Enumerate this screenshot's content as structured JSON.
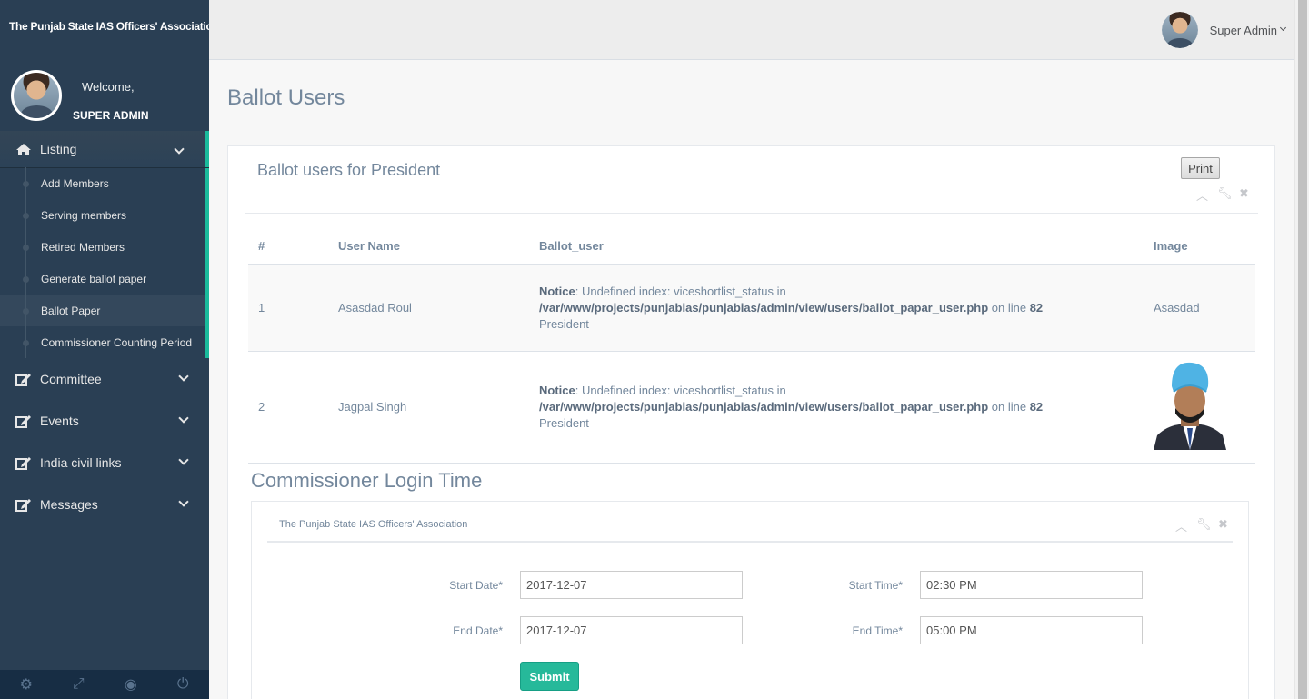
{
  "sidebar": {
    "site_title": "The Punjab State IAS Officers' Association",
    "welcome": "Welcome,",
    "admin_name": "SUPER ADMIN",
    "menu": [
      {
        "label": "Listing",
        "icon": "home-icon",
        "expanded": true,
        "items": [
          "Add Members",
          "Serving members",
          "Retired Members",
          "Generate ballot paper",
          "Ballot Paper",
          "Commissioner Counting Period"
        ]
      },
      {
        "label": "Committee",
        "icon": "edit-icon"
      },
      {
        "label": "Events",
        "icon": "edit-icon"
      },
      {
        "label": "India civil links",
        "icon": "edit-icon"
      },
      {
        "label": "Messages",
        "icon": "edit-icon"
      }
    ],
    "footer_icons": [
      "settings-icon",
      "fullscreen-icon",
      "lock-icon",
      "power-icon"
    ]
  },
  "topnav": {
    "user_name": "Super Admin"
  },
  "page": {
    "title": "Ballot Users",
    "panel_title": "Ballot users for President",
    "print_label": "Print",
    "table": {
      "headers": [
        "#",
        "User Name",
        "Ballot_user",
        "Image"
      ],
      "rows": [
        {
          "num": "1",
          "name": "Asasdad Roul",
          "notice_label": "Notice",
          "notice_text": ": Undefined index: viceshortlist_status in",
          "path": "/var/www/projects/punjabias/punjabias/admin/view/users/ballot_papar_user.php",
          "on_line": " on line ",
          "line_no": "82",
          "role": "President",
          "image": "Asasdad"
        },
        {
          "num": "2",
          "name": "Jagpal Singh",
          "notice_label": "Notice",
          "notice_text": ": Undefined index: viceshortlist_status in",
          "path": "/var/www/projects/punjabias/punjabias/admin/view/users/ballot_papar_user.php",
          "on_line": " on line ",
          "line_no": "82",
          "role": "President",
          "image": ""
        }
      ]
    },
    "section2_title": "Commissioner Login Time",
    "panel2_title": "The Punjab State IAS Officers' Association",
    "form": {
      "start_date_label": "Start Date*",
      "start_date_value": "2017-12-07",
      "end_date_label": "End Date*",
      "end_date_value": "2017-12-07",
      "start_time_label": "Start Time*",
      "start_time_value": "02:30 PM",
      "end_time_label": "End Time*",
      "end_time_value": "05:00 PM",
      "submit_label": "Submit"
    }
  },
  "colors": {
    "sidebar_bg": "#2a3f54",
    "accent": "#1abb9c",
    "submit": "#26b99a"
  }
}
